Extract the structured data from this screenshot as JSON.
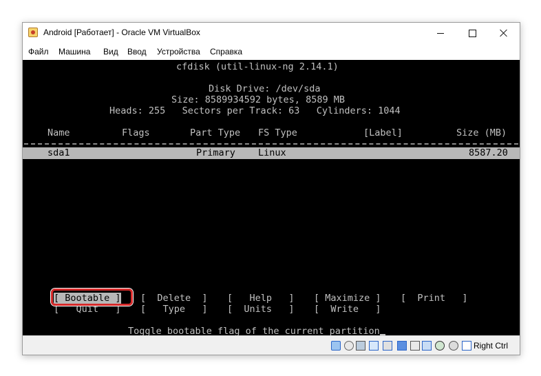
{
  "window": {
    "title": "Android [Работает] - Oracle VM VirtualBox"
  },
  "menu": {
    "items": [
      "Файл",
      "Машина",
      "Вид",
      "Ввод",
      "Устройства",
      "Справка"
    ]
  },
  "console": {
    "header": "cfdisk (util-linux-ng 2.14.1)",
    "disk_drive": "Disk Drive: /dev/sda",
    "size": "Size: 8589934592 bytes, 8589 MB",
    "geometry": "Heads: 255   Sectors per Track: 63   Cylinders: 1044",
    "columns": {
      "name": "Name",
      "flags": "Flags",
      "part_type": "Part Type",
      "fs_type": "FS Type",
      "label": "[Label]",
      "size": "Size (MB)"
    },
    "partition": {
      "name": "sda1",
      "flags": "",
      "part_type": "Primary",
      "fs_type": "Linux",
      "label": "",
      "size": "8587.20"
    },
    "commands": {
      "bootable": "[ Bootable ]",
      "delete": "[  Delete  ]",
      "help": "[   Help   ]",
      "maximize": "[ Maximize ]",
      "print": "[  Print   ]",
      "quit": "[   Quit   ]",
      "type": "[   Type   ]",
      "units": "[  Units   ]",
      "write": "[  Write   ]"
    },
    "status_message": "Toggle bootable flag of the current partition"
  },
  "statusbar": {
    "icons": [
      "hard-disk-icon",
      "optical-drive-icon",
      "usb-icon",
      "shared-folders-icon",
      "network-icon",
      "display-icon",
      "video-capture-icon",
      "network-adapter-icon",
      "cpu-icon",
      "mouse-integration-icon",
      "keyboard-icon"
    ],
    "host_key": "Right Ctrl"
  },
  "colors": {
    "console_bg": "#000000",
    "console_fg": "#c0c0c0",
    "selection_bg": "#b8b8b8",
    "highlight_outline": "#d62a2a"
  }
}
